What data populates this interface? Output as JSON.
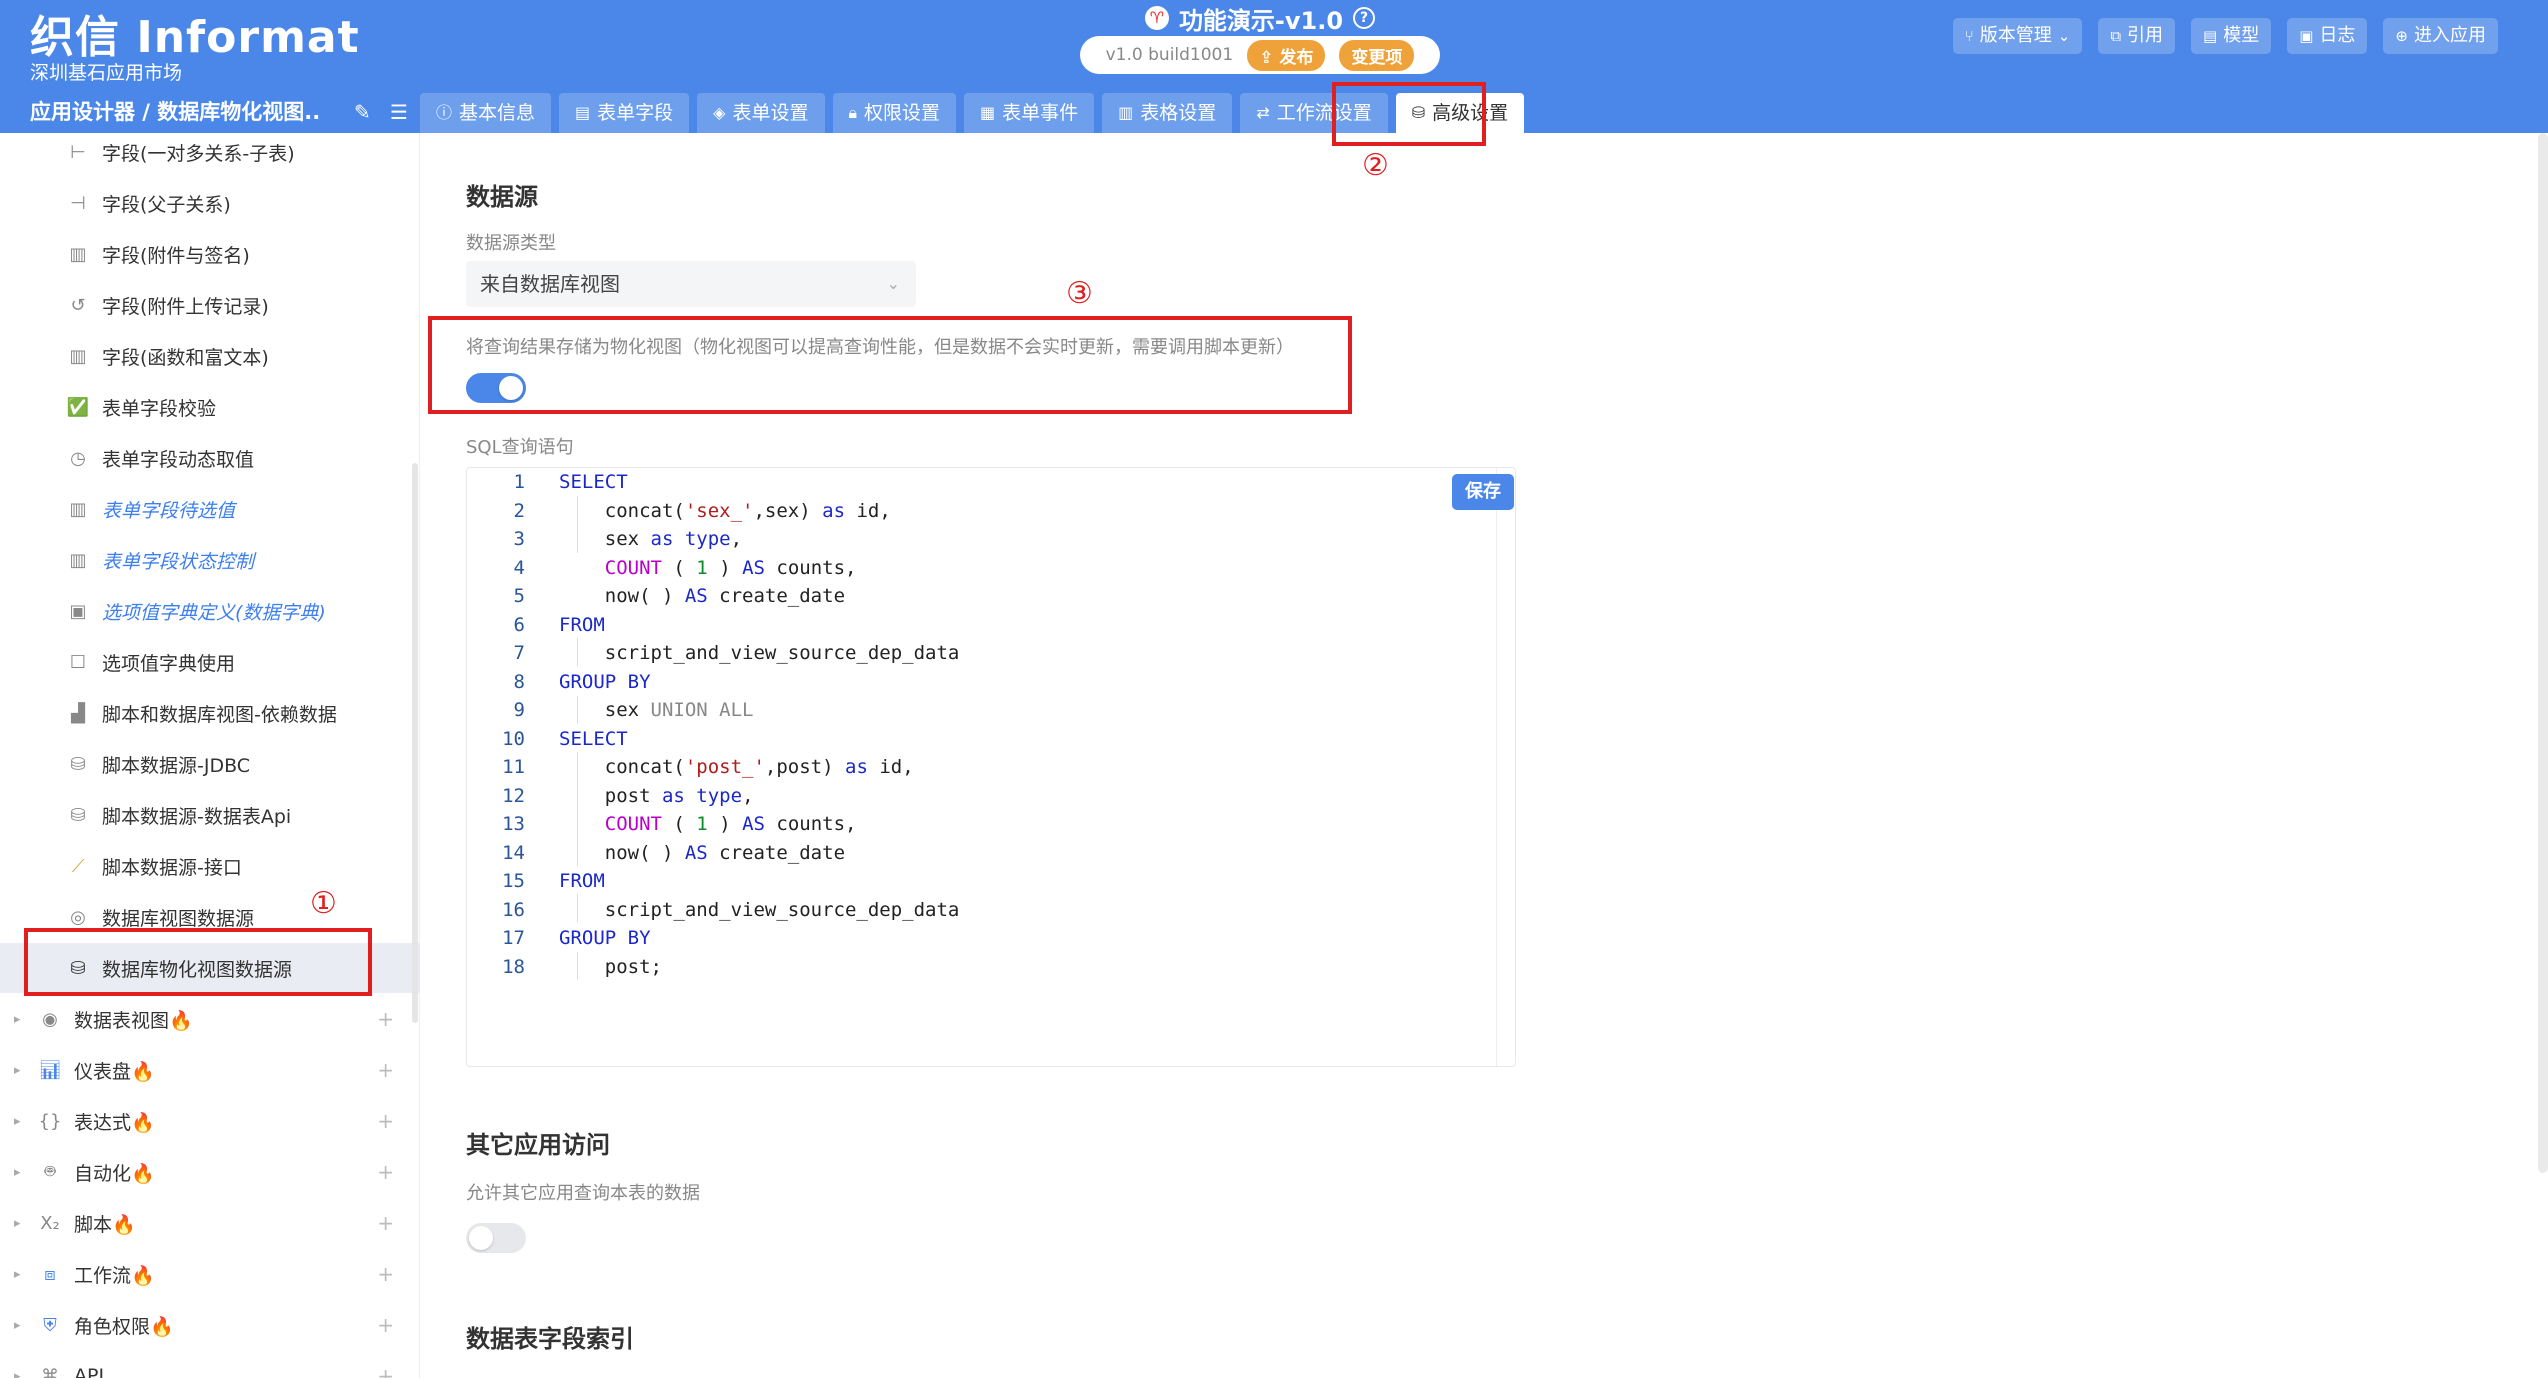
{
  "header": {
    "logo_title": "织信 Informat",
    "logo_subtitle": "深圳基石应用市场",
    "app_title": "功能演示-v1.0",
    "version": "v1.0 build1001",
    "publish_label": "发布",
    "changes_label": "变更项",
    "actions": [
      {
        "label": "版本管理",
        "icon": "branch-icon"
      },
      {
        "label": "引用",
        "icon": "link-icon"
      },
      {
        "label": "模型",
        "icon": "model-icon"
      },
      {
        "label": "日志",
        "icon": "log-icon"
      },
      {
        "label": "进入应用",
        "icon": "enter-icon"
      }
    ],
    "breadcrumb": "应用设计器 / 数据库物化视图...",
    "tabs": [
      {
        "label": "基本信息"
      },
      {
        "label": "表单字段"
      },
      {
        "label": "表单设置"
      },
      {
        "label": "权限设置"
      },
      {
        "label": "表单事件"
      },
      {
        "label": "表格设置"
      },
      {
        "label": "工作流设置"
      },
      {
        "label": "高级设置"
      }
    ]
  },
  "sidebar": {
    "items": [
      {
        "label": "字段(一对多关系-子表)"
      },
      {
        "label": "字段(父子关系)"
      },
      {
        "label": "字段(附件与签名)"
      },
      {
        "label": "字段(附件上传记录)"
      },
      {
        "label": "字段(函数和富文本)"
      },
      {
        "label": "表单字段校验"
      },
      {
        "label": "表单字段动态取值"
      },
      {
        "label": "表单字段待选值"
      },
      {
        "label": "表单字段状态控制"
      },
      {
        "label": "选项值字典定义(数据字典)"
      },
      {
        "label": "选项值字典使用"
      },
      {
        "label": "脚本和数据库视图-依赖数据"
      },
      {
        "label": "脚本数据源-JDBC"
      },
      {
        "label": "脚本数据源-数据表Api"
      },
      {
        "label": "脚本数据源-接口"
      },
      {
        "label": "数据库视图数据源"
      },
      {
        "label": "数据库物化视图数据源"
      }
    ],
    "groups": [
      {
        "label": "数据表视图🔥"
      },
      {
        "label": "仪表盘🔥"
      },
      {
        "label": "表达式🔥"
      },
      {
        "label": "自动化🔥"
      },
      {
        "label": "脚本🔥"
      },
      {
        "label": "工作流🔥"
      },
      {
        "label": "角色权限🔥"
      },
      {
        "label": "API"
      }
    ]
  },
  "main": {
    "datasource_title": "数据源",
    "datasource_type_label": "数据源类型",
    "datasource_type_value": "来自数据库视图",
    "materialize_label": "将查询结果存储为物化视图（物化视图可以提高查询性能，但是数据不会实时更新，需要调用脚本更新）",
    "materialize_on": true,
    "sql_label": "SQL查询语句",
    "save_label": "保存",
    "sql_lines": [
      "1",
      "2",
      "3",
      "4",
      "5",
      "6",
      "7",
      "8",
      "9",
      "10",
      "11",
      "12",
      "13",
      "14",
      "15",
      "16",
      "17",
      "18"
    ],
    "other_access_title": "其它应用访问",
    "other_access_label": "允许其它应用查询本表的数据",
    "other_access_on": false,
    "index_title": "数据表字段索引"
  },
  "annotations": {
    "one": "①",
    "two": "②",
    "three": "③"
  },
  "colors": {
    "primary": "#4a87e8",
    "accent_orange": "#f0a23a",
    "annotation_red": "#e02020"
  }
}
